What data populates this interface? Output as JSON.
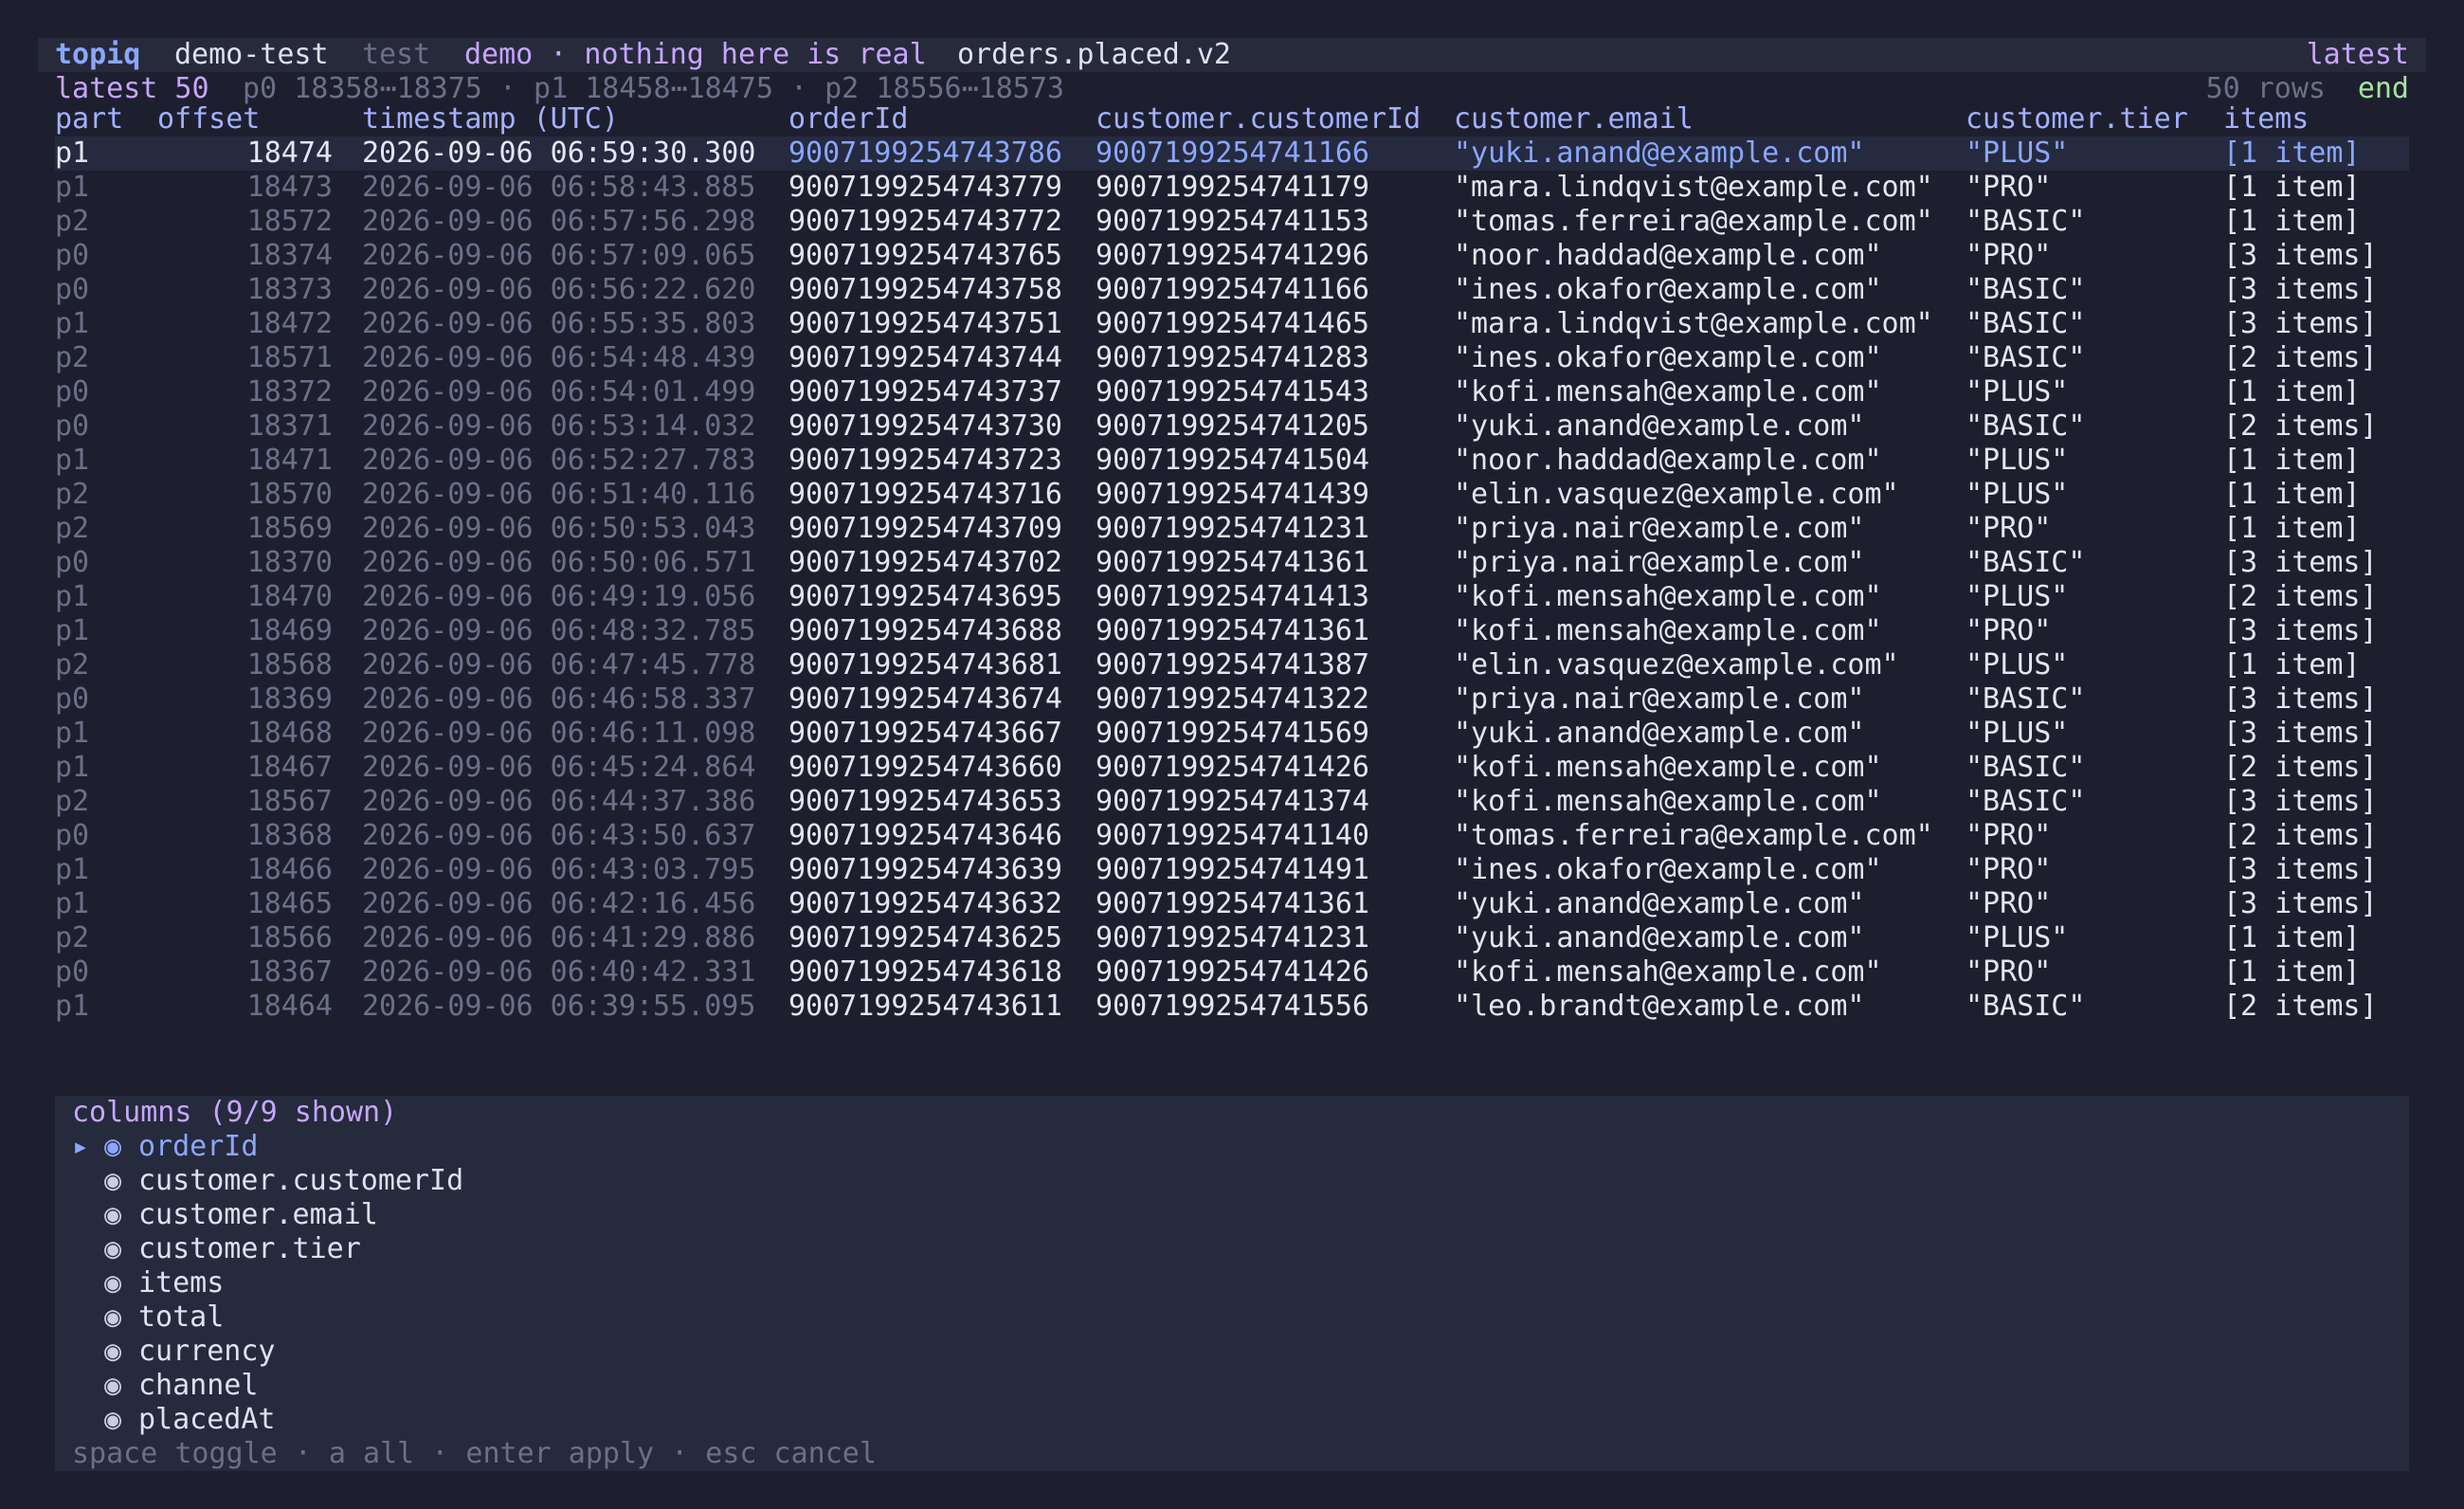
{
  "titlebar": {
    "brand": "topiq",
    "cluster": "demo-test",
    "env": "test",
    "banner": "demo · nothing here is real",
    "topic": "orders.placed.v2",
    "mode": "latest"
  },
  "status": {
    "view": "latest 50",
    "ranges": "p0 18358⋯18375 · p1 18458⋯18475 · p2 18556⋯18573",
    "rows": "50 rows",
    "position": "end"
  },
  "columns_header": {
    "part": "part",
    "offset": "offset",
    "timestamp": "timestamp (UTC)",
    "orderId": "orderId",
    "customerId": "customer.customerId",
    "email": "customer.email",
    "tier": "customer.tier",
    "items": "items"
  },
  "rows": [
    {
      "part": "p1",
      "offset": "18474",
      "ts": "2026-09-06 06:59:30.300",
      "orderId": "9007199254743786",
      "customerId": "9007199254741166",
      "email": "\"yuki.anand@example.com\"",
      "tier": "\"PLUS\"",
      "items": "[1 item]"
    },
    {
      "part": "p1",
      "offset": "18473",
      "ts": "2026-09-06 06:58:43.885",
      "orderId": "9007199254743779",
      "customerId": "9007199254741179",
      "email": "\"mara.lindqvist@example.com\"",
      "tier": "\"PRO\"",
      "items": "[1 item]"
    },
    {
      "part": "p2",
      "offset": "18572",
      "ts": "2026-09-06 06:57:56.298",
      "orderId": "9007199254743772",
      "customerId": "9007199254741153",
      "email": "\"tomas.ferreira@example.com\"",
      "tier": "\"BASIC\"",
      "items": "[1 item]"
    },
    {
      "part": "p0",
      "offset": "18374",
      "ts": "2026-09-06 06:57:09.065",
      "orderId": "9007199254743765",
      "customerId": "9007199254741296",
      "email": "\"noor.haddad@example.com\"",
      "tier": "\"PRO\"",
      "items": "[3 items]"
    },
    {
      "part": "p0",
      "offset": "18373",
      "ts": "2026-09-06 06:56:22.620",
      "orderId": "9007199254743758",
      "customerId": "9007199254741166",
      "email": "\"ines.okafor@example.com\"",
      "tier": "\"BASIC\"",
      "items": "[3 items]"
    },
    {
      "part": "p1",
      "offset": "18472",
      "ts": "2026-09-06 06:55:35.803",
      "orderId": "9007199254743751",
      "customerId": "9007199254741465",
      "email": "\"mara.lindqvist@example.com\"",
      "tier": "\"BASIC\"",
      "items": "[3 items]"
    },
    {
      "part": "p2",
      "offset": "18571",
      "ts": "2026-09-06 06:54:48.439",
      "orderId": "9007199254743744",
      "customerId": "9007199254741283",
      "email": "\"ines.okafor@example.com\"",
      "tier": "\"BASIC\"",
      "items": "[2 items]"
    },
    {
      "part": "p0",
      "offset": "18372",
      "ts": "2026-09-06 06:54:01.499",
      "orderId": "9007199254743737",
      "customerId": "9007199254741543",
      "email": "\"kofi.mensah@example.com\"",
      "tier": "\"PLUS\"",
      "items": "[1 item]"
    },
    {
      "part": "p0",
      "offset": "18371",
      "ts": "2026-09-06 06:53:14.032",
      "orderId": "9007199254743730",
      "customerId": "9007199254741205",
      "email": "\"yuki.anand@example.com\"",
      "tier": "\"BASIC\"",
      "items": "[2 items]"
    },
    {
      "part": "p1",
      "offset": "18471",
      "ts": "2026-09-06 06:52:27.783",
      "orderId": "9007199254743723",
      "customerId": "9007199254741504",
      "email": "\"noor.haddad@example.com\"",
      "tier": "\"PLUS\"",
      "items": "[1 item]"
    },
    {
      "part": "p2",
      "offset": "18570",
      "ts": "2026-09-06 06:51:40.116",
      "orderId": "9007199254743716",
      "customerId": "9007199254741439",
      "email": "\"elin.vasquez@example.com\"",
      "tier": "\"PLUS\"",
      "items": "[1 item]"
    },
    {
      "part": "p2",
      "offset": "18569",
      "ts": "2026-09-06 06:50:53.043",
      "orderId": "9007199254743709",
      "customerId": "9007199254741231",
      "email": "\"priya.nair@example.com\"",
      "tier": "\"PRO\"",
      "items": "[1 item]"
    },
    {
      "part": "p0",
      "offset": "18370",
      "ts": "2026-09-06 06:50:06.571",
      "orderId": "9007199254743702",
      "customerId": "9007199254741361",
      "email": "\"priya.nair@example.com\"",
      "tier": "\"BASIC\"",
      "items": "[3 items]"
    },
    {
      "part": "p1",
      "offset": "18470",
      "ts": "2026-09-06 06:49:19.056",
      "orderId": "9007199254743695",
      "customerId": "9007199254741413",
      "email": "\"kofi.mensah@example.com\"",
      "tier": "\"PLUS\"",
      "items": "[2 items]"
    },
    {
      "part": "p1",
      "offset": "18469",
      "ts": "2026-09-06 06:48:32.785",
      "orderId": "9007199254743688",
      "customerId": "9007199254741361",
      "email": "\"kofi.mensah@example.com\"",
      "tier": "\"PRO\"",
      "items": "[3 items]"
    },
    {
      "part": "p2",
      "offset": "18568",
      "ts": "2026-09-06 06:47:45.778",
      "orderId": "9007199254743681",
      "customerId": "9007199254741387",
      "email": "\"elin.vasquez@example.com\"",
      "tier": "\"PLUS\"",
      "items": "[1 item]"
    },
    {
      "part": "p0",
      "offset": "18369",
      "ts": "2026-09-06 06:46:58.337",
      "orderId": "9007199254743674",
      "customerId": "9007199254741322",
      "email": "\"priya.nair@example.com\"",
      "tier": "\"BASIC\"",
      "items": "[3 items]"
    },
    {
      "part": "p1",
      "offset": "18468",
      "ts": "2026-09-06 06:46:11.098",
      "orderId": "9007199254743667",
      "customerId": "9007199254741569",
      "email": "\"yuki.anand@example.com\"",
      "tier": "\"PLUS\"",
      "items": "[3 items]"
    },
    {
      "part": "p1",
      "offset": "18467",
      "ts": "2026-09-06 06:45:24.864",
      "orderId": "9007199254743660",
      "customerId": "9007199254741426",
      "email": "\"kofi.mensah@example.com\"",
      "tier": "\"BASIC\"",
      "items": "[2 items]"
    },
    {
      "part": "p2",
      "offset": "18567",
      "ts": "2026-09-06 06:44:37.386",
      "orderId": "9007199254743653",
      "customerId": "9007199254741374",
      "email": "\"kofi.mensah@example.com\"",
      "tier": "\"BASIC\"",
      "items": "[3 items]"
    },
    {
      "part": "p0",
      "offset": "18368",
      "ts": "2026-09-06 06:43:50.637",
      "orderId": "9007199254743646",
      "customerId": "9007199254741140",
      "email": "\"tomas.ferreira@example.com\"",
      "tier": "\"PRO\"",
      "items": "[2 items]"
    },
    {
      "part": "p1",
      "offset": "18466",
      "ts": "2026-09-06 06:43:03.795",
      "orderId": "9007199254743639",
      "customerId": "9007199254741491",
      "email": "\"ines.okafor@example.com\"",
      "tier": "\"PRO\"",
      "items": "[3 items]"
    },
    {
      "part": "p1",
      "offset": "18465",
      "ts": "2026-09-06 06:42:16.456",
      "orderId": "9007199254743632",
      "customerId": "9007199254741361",
      "email": "\"yuki.anand@example.com\"",
      "tier": "\"PRO\"",
      "items": "[3 items]"
    },
    {
      "part": "p2",
      "offset": "18566",
      "ts": "2026-09-06 06:41:29.886",
      "orderId": "9007199254743625",
      "customerId": "9007199254741231",
      "email": "\"yuki.anand@example.com\"",
      "tier": "\"PLUS\"",
      "items": "[1 item]"
    },
    {
      "part": "p0",
      "offset": "18367",
      "ts": "2026-09-06 06:40:42.331",
      "orderId": "9007199254743618",
      "customerId": "9007199254741426",
      "email": "\"kofi.mensah@example.com\"",
      "tier": "\"PRO\"",
      "items": "[1 item]"
    },
    {
      "part": "p1",
      "offset": "18464",
      "ts": "2026-09-06 06:39:55.095",
      "orderId": "9007199254743611",
      "customerId": "9007199254741556",
      "email": "\"leo.brandt@example.com\"",
      "tier": "\"BASIC\"",
      "items": "[2 items]"
    }
  ],
  "picker": {
    "title": "columns (9/9 shown)",
    "cursor_glyph": "▸",
    "radio_glyph": "◉",
    "items": [
      "orderId",
      "customer.customerId",
      "customer.email",
      "customer.tier",
      "items",
      "total",
      "currency",
      "channel",
      "placedAt"
    ],
    "help": "space toggle · a all · enter apply · esc cancel"
  }
}
